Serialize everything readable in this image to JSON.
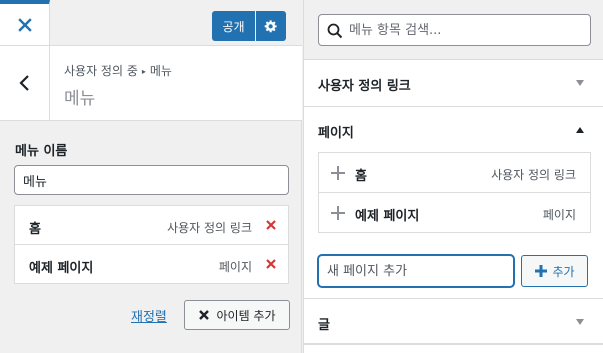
{
  "topbar": {
    "close_icon": "close-icon",
    "publish_label": "공개",
    "settings_icon": "gear-icon"
  },
  "section": {
    "breadcrumb_parent": "사용자 정의 중",
    "breadcrumb_sep": "▸",
    "breadcrumb_current": "메뉴",
    "title": "메뉴"
  },
  "menu_name": {
    "label": "메뉴 이름",
    "value": "메뉴"
  },
  "menu_items": [
    {
      "title": "홈",
      "type": "사용자 정의 링크"
    },
    {
      "title": "예제 페이지",
      "type": "페이지"
    }
  ],
  "actions": {
    "reorder_label": "재정렬",
    "add_items_label": "아이템 추가"
  },
  "search": {
    "placeholder": "메뉴 항목 검색..."
  },
  "accordions": {
    "custom_links": "사용자 정의 링크",
    "pages": "페이지",
    "posts": "글"
  },
  "pages": [
    {
      "title": "홈",
      "type": "사용자 정의 링크"
    },
    {
      "title": "예제 페이지",
      "type": "페이지"
    }
  ],
  "new_page": {
    "placeholder": "새 페이지 추가",
    "add_label": "추가"
  },
  "colors": {
    "accent": "#2271b1",
    "remove": "#d63638"
  }
}
